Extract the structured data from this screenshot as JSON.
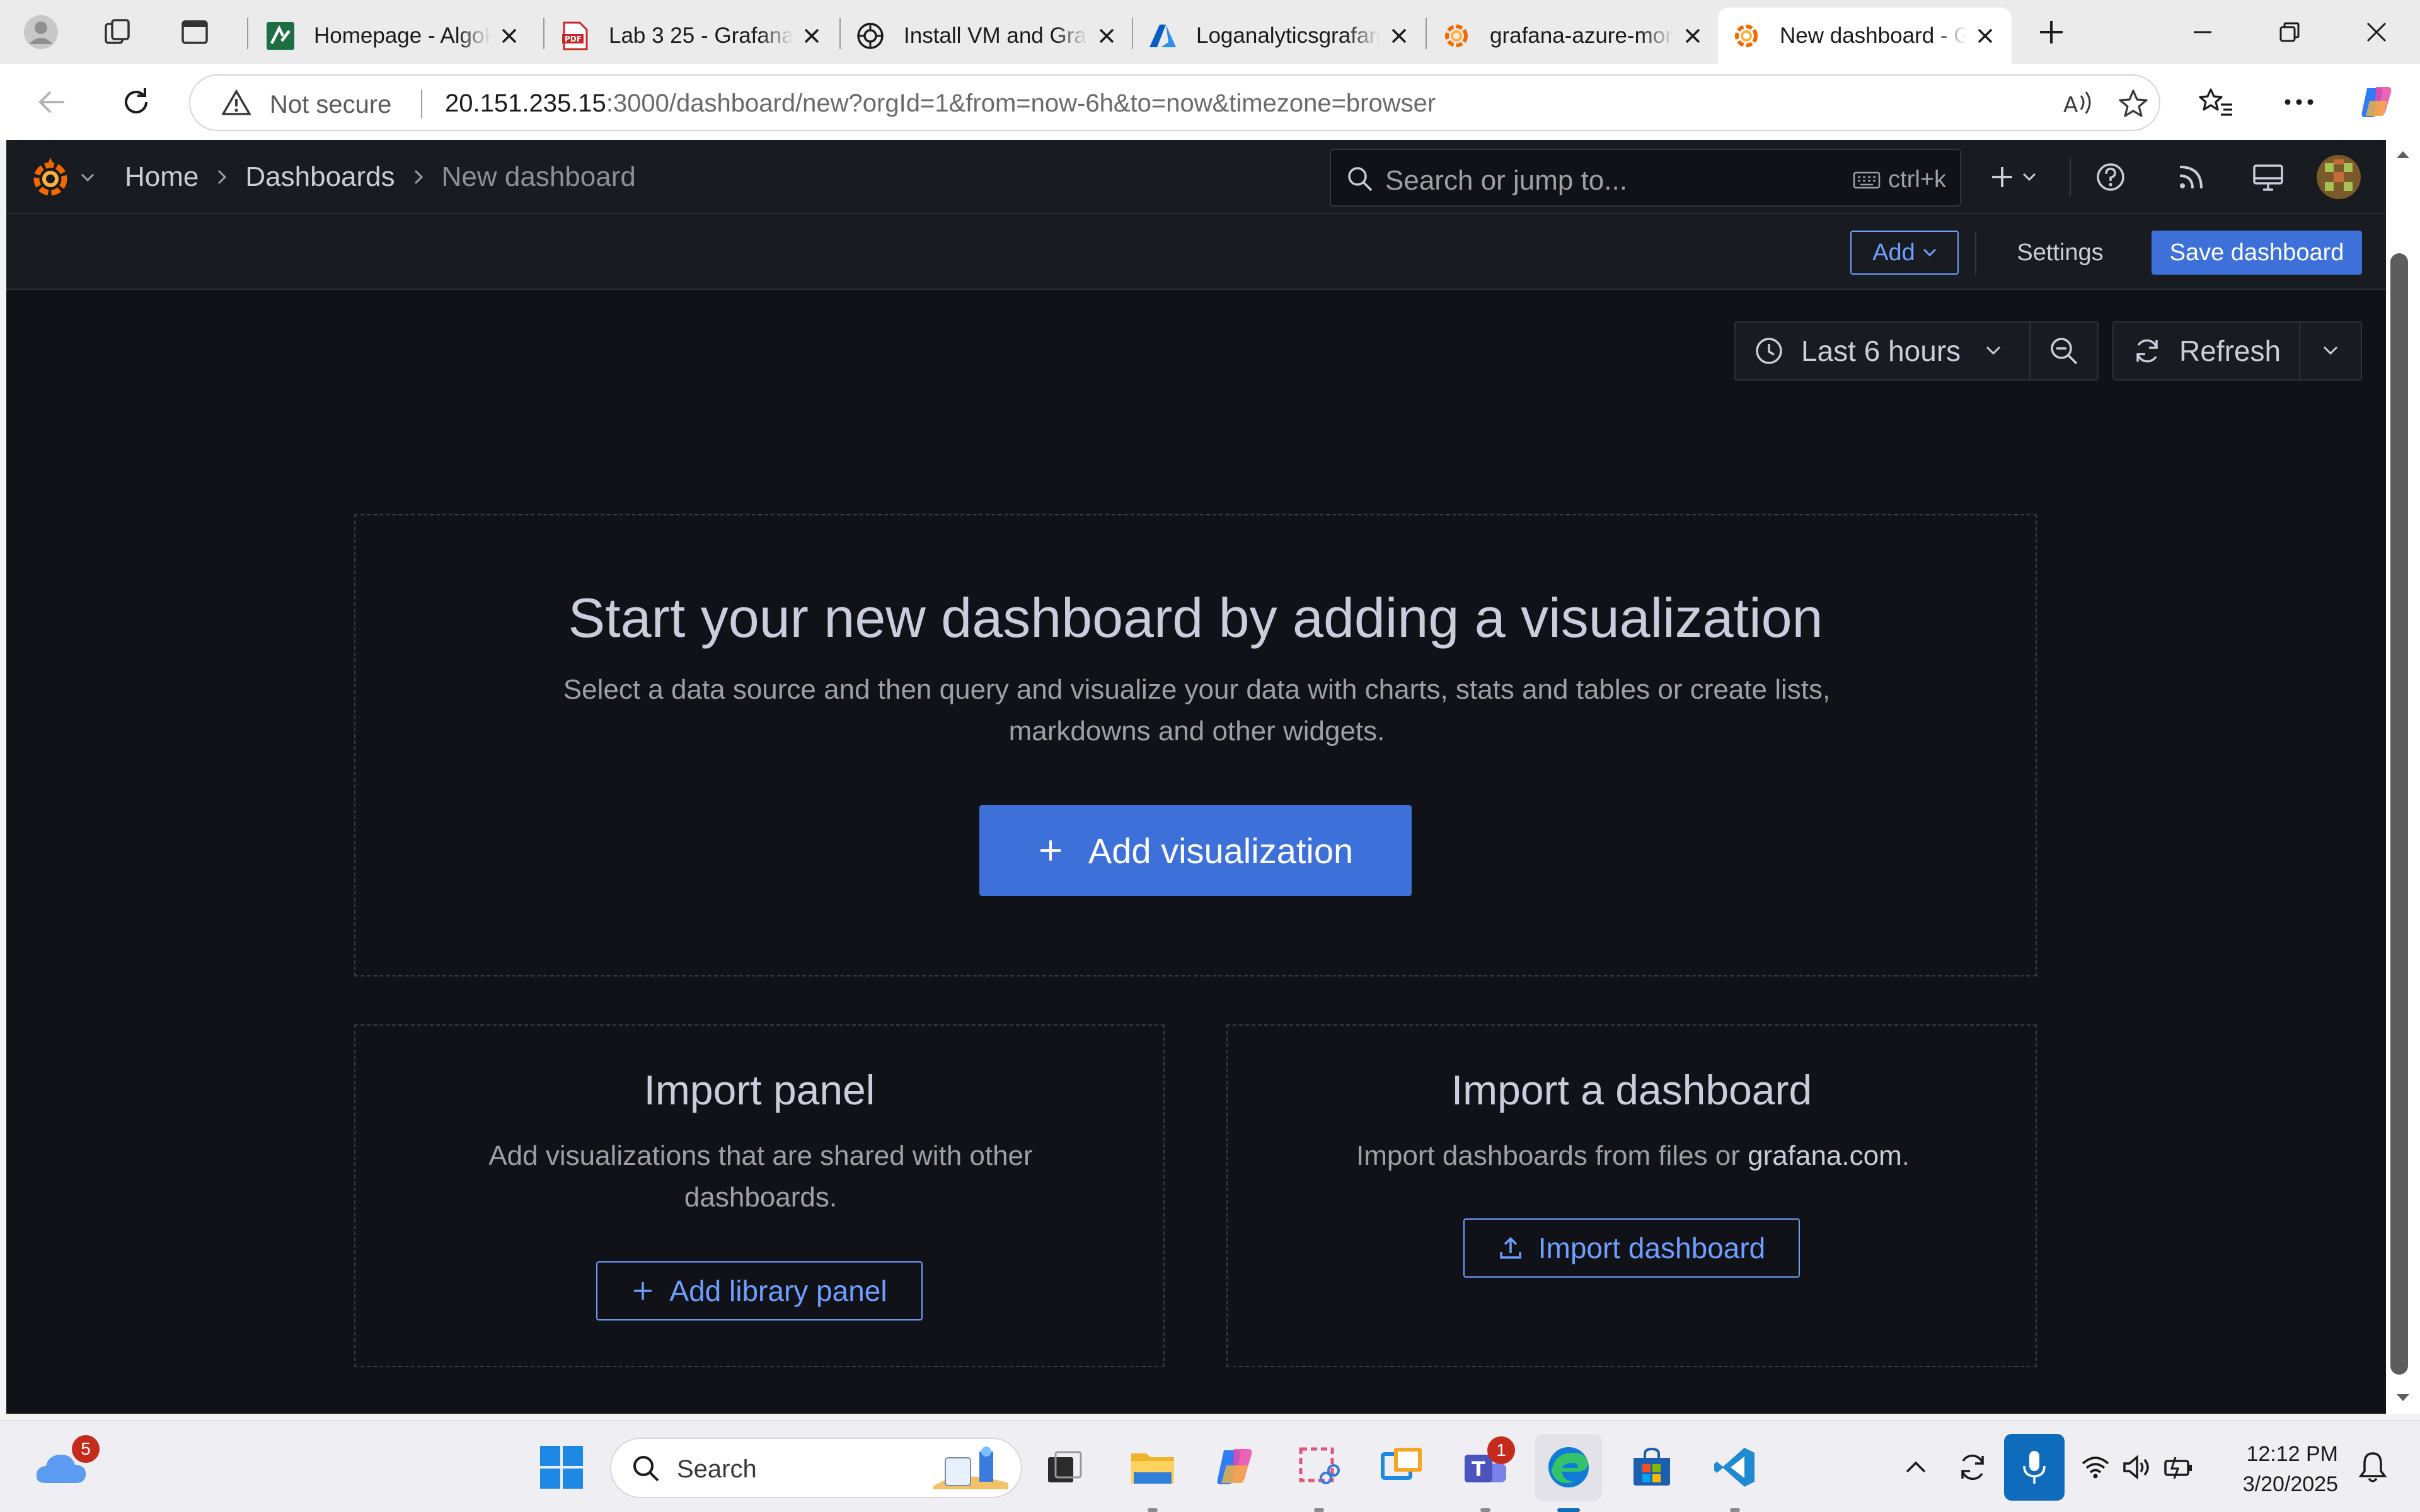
{
  "browser": {
    "tabs": [
      {
        "title": "Homepage - AlgoExpert",
        "favicon": "algoexpert-icon"
      },
      {
        "title": "Lab 3 25 - Grafana",
        "favicon": "pdf-icon"
      },
      {
        "title": "Install VM and Grafana",
        "favicon": "chatgpt-icon"
      },
      {
        "title": "Loganalyticsgrafana",
        "favicon": "azure-icon"
      },
      {
        "title": "grafana-azure-monitoring",
        "favicon": "grafana-icon"
      },
      {
        "title": "New dashboard - Grafana",
        "favicon": "grafana-icon",
        "active": true
      }
    ],
    "security_label": "Not secure",
    "url_host": "20.151.235.15",
    "url_rest": ":3000/dashboard/new?orgId=1&from=now-6h&to=now&timezone=browser"
  },
  "grafana": {
    "breadcrumb": [
      "Home",
      "Dashboards",
      "New dashboard"
    ],
    "search_placeholder": "Search or jump to...",
    "search_shortcut": "ctrl+k",
    "toolbar": {
      "add_label": "Add",
      "settings_label": "Settings",
      "save_label": "Save dashboard"
    },
    "time_range": "Last 6 hours",
    "refresh_label": "Refresh",
    "empty": {
      "title": "Start your new dashboard by adding a visualization",
      "description_line1": "Select a data source and then query and visualize your data with charts, stats and tables or create lists,",
      "description_line2": "markdowns and other widgets.",
      "add_button": "Add visualization"
    },
    "import_panel": {
      "title": "Import panel",
      "description_line1": "Add visualizations that are shared with other",
      "description_line2": "dashboards.",
      "button": "Add library panel"
    },
    "import_dashboard": {
      "title": "Import a dashboard",
      "description_prefix": "Import dashboards from files or ",
      "description_link": "grafana.com",
      "description_suffix": ".",
      "button": "Import dashboard"
    }
  },
  "taskbar": {
    "weather_badge": "5",
    "search_placeholder": "Search",
    "teams_badge": "1",
    "time": "12:12 PM",
    "date": "3/20/2025"
  },
  "colors": {
    "accent": "#3d71d9",
    "link": "#6e9fff",
    "app_bg": "#111217",
    "nav_bg": "#181b1f"
  }
}
